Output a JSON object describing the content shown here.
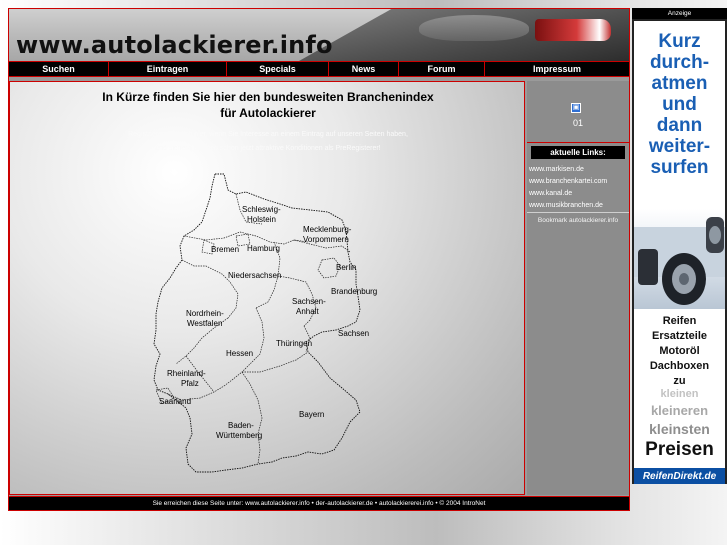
{
  "header": {
    "logo_text": "www.autolackierer.info"
  },
  "nav": [
    {
      "label": "Suchen",
      "w": 100
    },
    {
      "label": "Eintragen",
      "w": 118
    },
    {
      "label": "Specials",
      "w": 102
    },
    {
      "label": "News",
      "w": 70
    },
    {
      "label": "Forum",
      "w": 86
    },
    {
      "label": "Impressum",
      "w": 144
    }
  ],
  "main": {
    "title_line1": "In Kürze finden Sie hier den bundesweiten Branchenindex",
    "title_line2": "für Autolackierer",
    "text_line1": "Registrieren Sie sich hier, wenn Sie Interesse an einem Eintrag auf unseren Seiten haben,",
    "text_line2": "und sichern Sie sich schon jetzt attraktive Konditionen als PreRegisterer!"
  },
  "map": {
    "states": [
      {
        "name": "Schleswig-\nHolstein"
      },
      {
        "name": "Mecklenburg-\nVorpommern"
      },
      {
        "name": "Bremen"
      },
      {
        "name": "Hamburg"
      },
      {
        "name": "Niedersachsen"
      },
      {
        "name": "Berlin"
      },
      {
        "name": "Brandenburg"
      },
      {
        "name": "Sachsen-\nAnhalt"
      },
      {
        "name": "Nordrhein-\nWestfalen"
      },
      {
        "name": "Sachsen"
      },
      {
        "name": "Thüringen"
      },
      {
        "name": "Hessen"
      },
      {
        "name": "Rheinland-\nPfalz"
      },
      {
        "name": "Saarland"
      },
      {
        "name": "Bayern"
      },
      {
        "name": "Baden-\nWürttemberg"
      }
    ]
  },
  "sidebar": {
    "counter_value": "01",
    "links_heading": "aktuelle Links:",
    "links": [
      "www.markisen.de",
      "www.branchenkartei.com",
      "www.kanal.de",
      "www.musikbranchen.de"
    ],
    "bookmark": "Bookmark autolackierer.info"
  },
  "footer": {
    "text": "Sie erreichen diese Seite unter: www.autolackierer.info • der-autolackierer.de • autolackiererei.info • © 2004 IntroNet"
  },
  "ad": {
    "label": "Anzeige",
    "headline": "Kurz\ndurch-\natmen\nund\ndann\nweiter-\nsurfen",
    "products": "Reifen\nErsatzteile\nMotoröl\nDachboxen\nzu",
    "small1": "kleinen",
    "small2": "kleineren",
    "small3": "kleinsten",
    "big": "Preisen",
    "brand": "ReifenDirekt.de",
    "colors": {
      "headline": "#1a5fb4",
      "brand_bg": "#0b4fa3"
    }
  },
  "colors": {
    "accent": "#cc0000",
    "bar": "#000000"
  }
}
